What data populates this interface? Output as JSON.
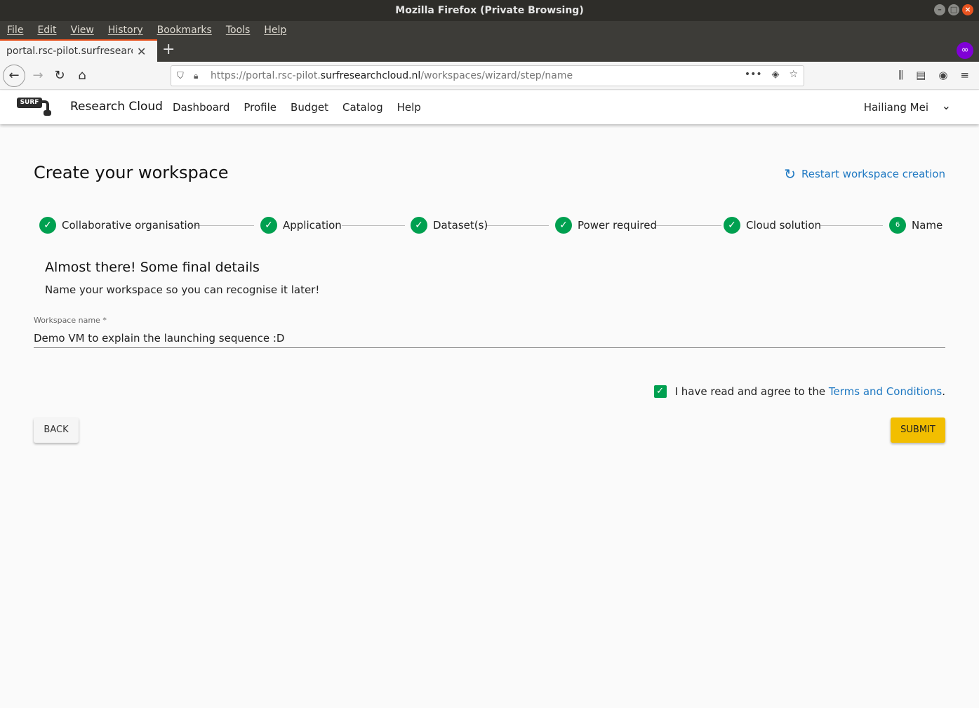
{
  "window": {
    "title": "Mozilla Firefox (Private Browsing)",
    "controls": {
      "minimize": "–",
      "maximize": "□",
      "close": "×"
    }
  },
  "menubar": {
    "items": [
      "File",
      "Edit",
      "View",
      "History",
      "Bookmarks",
      "Tools",
      "Help"
    ]
  },
  "tab": {
    "title": "portal.rsc-pilot.surfresearchcloud.nl",
    "close_glyph": "✕",
    "new_tab_glyph": "+"
  },
  "nav": {
    "back_glyph": "←",
    "forward_glyph": "→",
    "reload_glyph": "↻",
    "home_glyph": "⌂",
    "url_prefix": "https://portal.rsc-pilot.",
    "url_domain": "surfresearchcloud.nl",
    "url_path": "/workspaces/wizard/step/name",
    "page_actions_glyph": "•••",
    "pocket_glyph": "◈",
    "bookmark_glyph": "☆",
    "library_glyph": "⫼",
    "sidebar_glyph": "▤",
    "account_glyph": "◉",
    "menu_glyph": "≡"
  },
  "app": {
    "logo_text": "SURF",
    "brand": "Research Cloud",
    "nav": [
      "Dashboard",
      "Profile",
      "Budget",
      "Catalog",
      "Help"
    ],
    "user": "Hailiang Mei",
    "user_chevron": "⌄"
  },
  "main": {
    "title": "Create your workspace",
    "restart_label": "Restart workspace creation",
    "restart_glyph": "↻",
    "steps": [
      {
        "label": "Collaborative organisation",
        "icon": "✓"
      },
      {
        "label": "Application",
        "icon": "✓"
      },
      {
        "label": "Dataset(s)",
        "icon": "✓"
      },
      {
        "label": "Power required",
        "icon": "✓"
      },
      {
        "label": "Cloud solution",
        "icon": "✓"
      },
      {
        "label": "Name",
        "icon": "6"
      }
    ],
    "section_title": "Almost there! Some final details",
    "section_sub": "Name your workspace so you can recognise it later!",
    "field_label": "Workspace name *",
    "field_value": "Demo VM to explain the launching sequence :D",
    "terms_prefix": "I have read and agree to the ",
    "terms_link": "Terms and Conditions",
    "terms_suffix": ".",
    "checkbox_glyph": "✓",
    "back_label": "BACK",
    "submit_label": "SUBMIT"
  },
  "colors": {
    "accent": "#00a050",
    "link": "#1e78c2",
    "submit": "#f2be00",
    "firefox_tab_highlight": "#e95420",
    "private": "#8000d7"
  }
}
